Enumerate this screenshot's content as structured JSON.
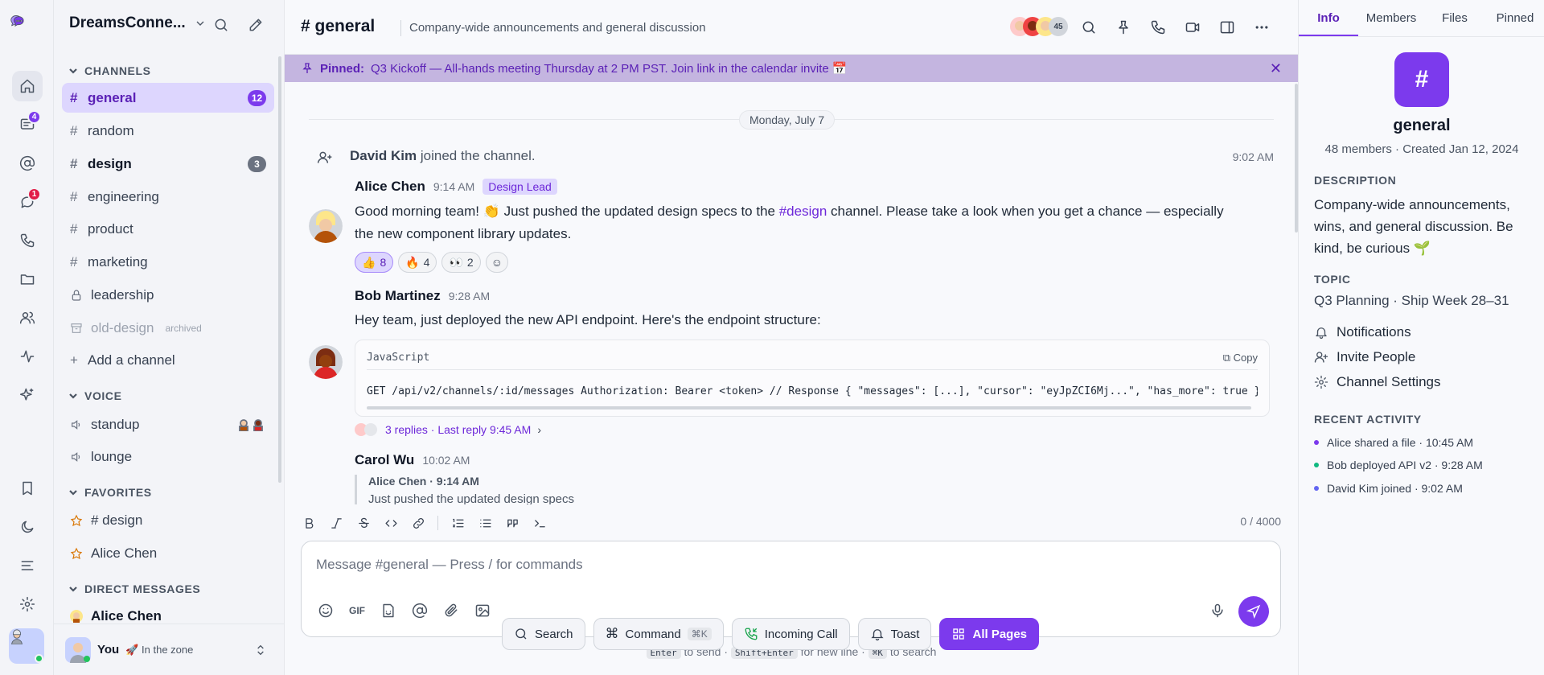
{
  "rail": {
    "chat_badge": "4",
    "dm_badge": "1"
  },
  "sidebar": {
    "workspace": "DreamsConne...",
    "channels_header": "CHANNELS",
    "channels": [
      {
        "name": "general",
        "count": "12"
      },
      {
        "name": "random"
      },
      {
        "name": "design",
        "count": "3"
      },
      {
        "name": "engineering"
      },
      {
        "name": "product"
      },
      {
        "name": "marketing"
      },
      {
        "name": "leadership"
      },
      {
        "name": "old-design",
        "tag": "archived"
      }
    ],
    "add_channel": "Add a channel",
    "voice_header": "VOICE",
    "voice": [
      "standup",
      "lounge"
    ],
    "favorites_header": "FAVORITES",
    "favorites": [
      "# design",
      "Alice Chen"
    ],
    "dm_header": "DIRECT MESSAGES",
    "dms": [
      "Alice Chen"
    ],
    "user": {
      "name": "You",
      "status": "🚀 In the zone"
    }
  },
  "header": {
    "title": "# general",
    "description": "Company-wide announcements and general discussion",
    "member_count": "45"
  },
  "pinned": {
    "label": "Pinned:",
    "text": "Q3 Kickoff — All-hands meeting Thursday at 2 PM PST. Join link in the calendar invite 📅"
  },
  "messages": {
    "date": "Monday, July 7",
    "system": {
      "who": "David Kim",
      "text": " joined the channel.",
      "time": "9:02 AM"
    },
    "alice": {
      "author": "Alice Chen",
      "time": "9:14 AM",
      "role": "Design Lead",
      "text_1": "Good morning team! 👏 Just pushed the updated design specs to the ",
      "link": "#design",
      "text_2": " channel. Please take a look when you get a chance — especially",
      "text_3": "the new component library updates.",
      "reactions": [
        {
          "emoji": "👍",
          "count": "8"
        },
        {
          "emoji": "🔥",
          "count": "4"
        },
        {
          "emoji": "👀",
          "count": "2"
        }
      ]
    },
    "bob": {
      "author": "Bob Martinez",
      "time": "9:28 AM",
      "text": "Hey team, just deployed the new API endpoint. Here's the endpoint structure:",
      "code_lang": "JavaScript",
      "copy": "Copy",
      "code": "GET /api/v2/channels/:id/messages Authorization: Bearer <token> // Response { \"messages\": [...], \"cursor\": \"eyJpZCI6Mj...\", \"has_more\": true }",
      "replies": "3 replies · Last reply 9:45 AM"
    },
    "carol": {
      "author": "Carol Wu",
      "time": "10:02 AM",
      "quote_author": "Alice Chen · 9:14 AM",
      "quote_text": "Just pushed the updated design specs"
    }
  },
  "composer": {
    "char_count": "0 / 4000",
    "placeholder": "Message #general — Press / for commands",
    "gif": "GIF",
    "hint_enter": "Enter",
    "hint_1": " to send · ",
    "hint_shift": "Shift+Enter",
    "hint_2": " for new line · ",
    "hint_k": "⌘K",
    "hint_3": " to search"
  },
  "devbar": {
    "search": "Search",
    "command": "Command",
    "command_key": "⌘K",
    "call": "Incoming Call",
    "toast": "Toast",
    "all_pages": "All Pages"
  },
  "rpanel": {
    "tabs": [
      "Info",
      "Members",
      "Files",
      "Pinned"
    ],
    "icon": "#",
    "name": "general",
    "meta": "48 members · Created Jan 12, 2024",
    "description_h": "DESCRIPTION",
    "description": "Company-wide announcements, wins, and general discussion. Be kind, be curious 🌱",
    "topic_h": "TOPIC",
    "topic": "Q3 Planning · Ship Week 28–31",
    "links": [
      "Notifications",
      "Invite People",
      "Channel Settings"
    ],
    "activity_h": "RECENT ACTIVITY",
    "activity": [
      "Alice shared a file · 10:45 AM",
      "Bob deployed API v2 · 9:28 AM",
      "David Kim joined · 9:02 AM"
    ],
    "activity_colors": [
      "#7c3aed",
      "#10b981",
      "#6366f1"
    ]
  }
}
